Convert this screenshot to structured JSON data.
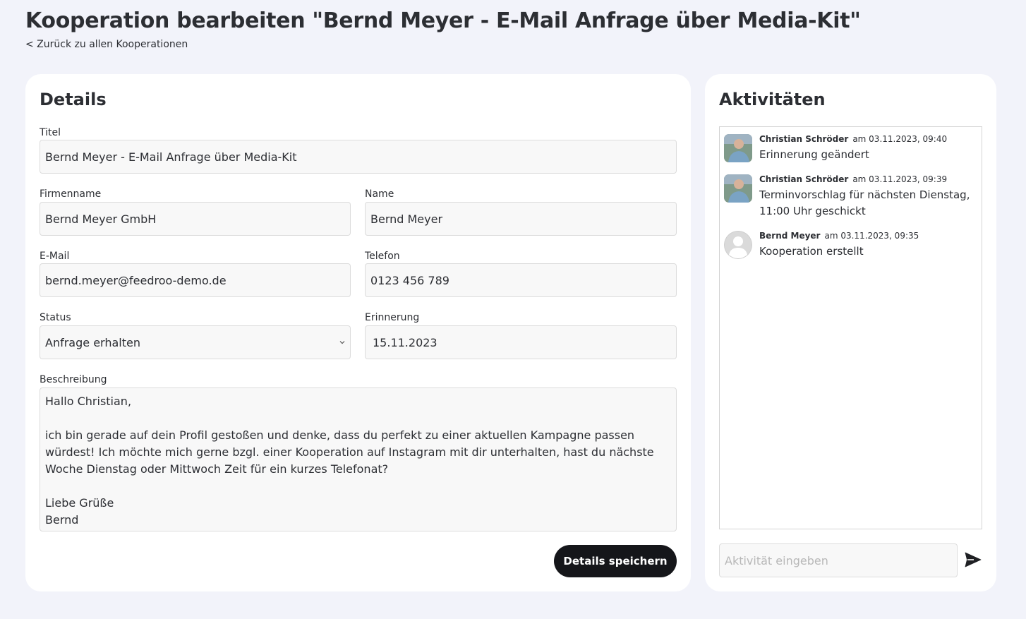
{
  "header": {
    "title": "Kooperation bearbeiten \"Bernd Meyer - E-Mail Anfrage über Media-Kit\"",
    "back_link": "< Zurück zu allen Kooperationen"
  },
  "details": {
    "heading": "Details",
    "title_label": "Titel",
    "title_value": "Bernd Meyer - E-Mail Anfrage über Media-Kit",
    "company_label": "Firmenname",
    "company_value": "Bernd Meyer GmbH",
    "name_label": "Name",
    "name_value": "Bernd Meyer",
    "email_label": "E-Mail",
    "email_value": "bernd.meyer@feedroo-demo.de",
    "phone_label": "Telefon",
    "phone_value": "0123 456 789",
    "status_label": "Status",
    "status_value": "Anfrage erhalten",
    "reminder_label": "Erinnerung",
    "reminder_value": "15.11.2023",
    "description_label": "Beschreibung",
    "description_value": "Hallo Christian,\n\nich bin gerade auf dein Profil gestoßen und denke, dass du perfekt zu einer aktuellen Kampagne passen würdest! Ich möchte mich gerne bzgl. einer Kooperation auf Instagram mit dir unterhalten, hast du nächste Woche Dienstag oder Mittwoch Zeit für ein kurzes Telefonat?\n\nLiebe Grüße\nBernd",
    "save_label": "Details speichern"
  },
  "activities": {
    "heading": "Aktivitäten",
    "items": [
      {
        "author": "Christian Schröder",
        "date": "am 03.11.2023, 09:40",
        "text": "Erinnerung geändert",
        "avatar": "photo-avatar"
      },
      {
        "author": "Christian Schröder",
        "date": "am 03.11.2023, 09:39",
        "text": "Terminvorschlag für nächsten Dienstag, 11:00 Uhr geschickt",
        "avatar": "photo-avatar"
      },
      {
        "author": "Bernd Meyer",
        "date": "am 03.11.2023, 09:35",
        "text": "Kooperation erstellt",
        "avatar": "default-user-avatar"
      }
    ],
    "input_placeholder": "Aktivität eingeben",
    "send_icon": "send-icon"
  }
}
